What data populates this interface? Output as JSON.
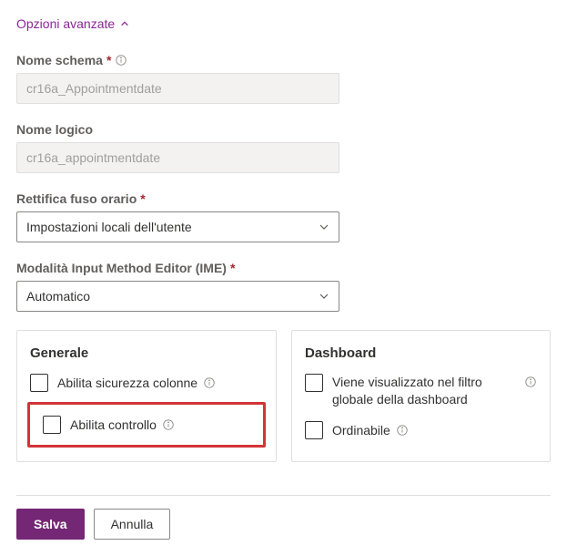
{
  "header": {
    "advanced_options": "Opzioni avanzate"
  },
  "fields": {
    "schema_name": {
      "label": "Nome schema",
      "value": "cr16a_Appointmentdate"
    },
    "logical_name": {
      "label": "Nome logico",
      "value": "cr16a_appointmentdate"
    },
    "timezone": {
      "label": "Rettifica fuso orario",
      "value": "Impostazioni locali dell'utente"
    },
    "ime": {
      "label": "Modalità Input Method Editor (IME)",
      "value": "Automatico"
    }
  },
  "panels": {
    "general": {
      "title": "Generale",
      "column_security": "Abilita sicurezza colonne",
      "enable_control": "Abilita controllo"
    },
    "dashboard": {
      "title": "Dashboard",
      "global_filter": "Viene visualizzato nel filtro globale della dashboard",
      "sortable": "Ordinabile"
    }
  },
  "footer": {
    "save": "Salva",
    "cancel": "Annulla"
  }
}
